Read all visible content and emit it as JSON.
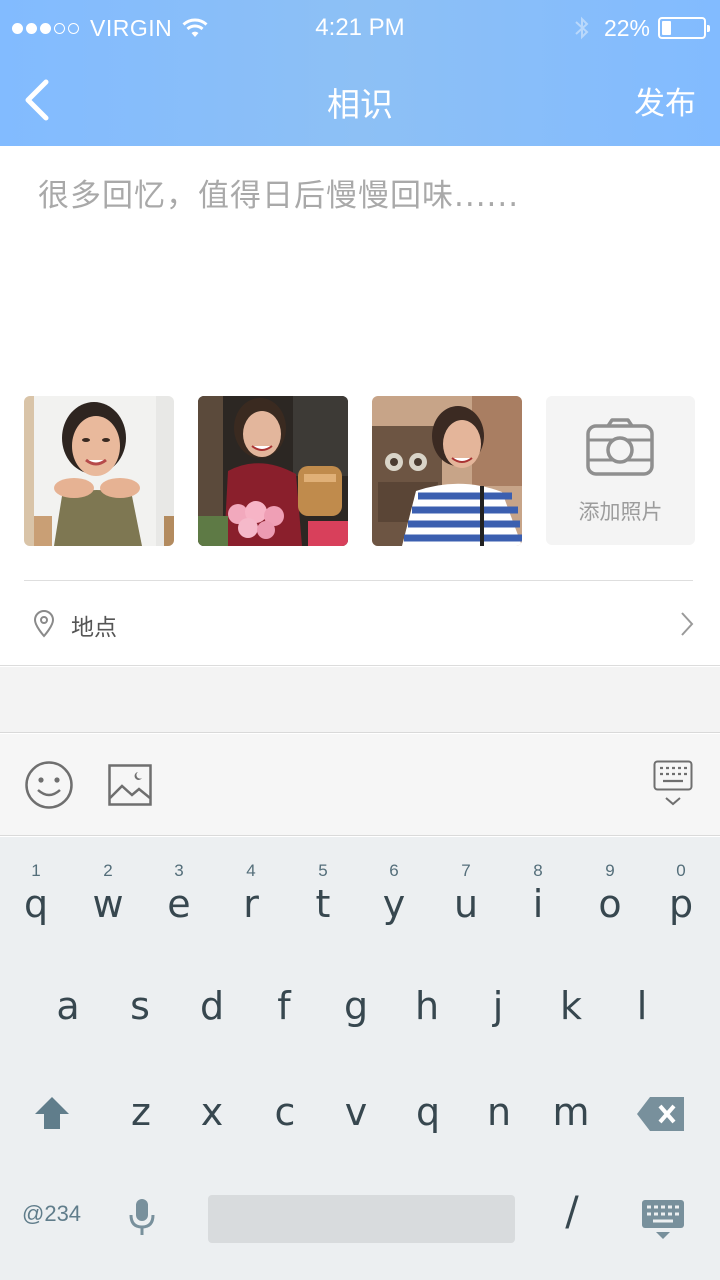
{
  "status_bar": {
    "carrier": "VIRGIN",
    "time": "4:21 PM",
    "battery_percent": "22%",
    "battery_level": 0.22,
    "signal_dots_filled": 3,
    "signal_dots_total": 5
  },
  "nav": {
    "back_icon": "chevron-left-icon",
    "title": "相识",
    "publish_label": "发布"
  },
  "composer": {
    "placeholder": "很多回忆，值得日后慢慢回味......"
  },
  "photos": {
    "items": [
      {
        "name": "photo-1",
        "description_icon": "photo-thumbnail"
      },
      {
        "name": "photo-2",
        "description_icon": "photo-thumbnail"
      },
      {
        "name": "photo-3",
        "description_icon": "photo-thumbnail"
      }
    ],
    "add_label": "添加照片",
    "add_icon": "camera-icon"
  },
  "location": {
    "label": "地点",
    "icon": "location-pin-icon",
    "chevron": "chevron-right-icon"
  },
  "toolbar": {
    "emoji_icon": "smiley-icon",
    "image_icon": "image-icon",
    "keyboard_icon": "keyboard-toggle-icon"
  },
  "keyboard": {
    "row1": [
      {
        "hint": "1",
        "ch": "q"
      },
      {
        "hint": "2",
        "ch": "w"
      },
      {
        "hint": "3",
        "ch": "e"
      },
      {
        "hint": "4",
        "ch": "r"
      },
      {
        "hint": "5",
        "ch": "t"
      },
      {
        "hint": "6",
        "ch": "y"
      },
      {
        "hint": "7",
        "ch": "u"
      },
      {
        "hint": "8",
        "ch": "i"
      },
      {
        "hint": "9",
        "ch": "o"
      },
      {
        "hint": "0",
        "ch": "p"
      }
    ],
    "row2": [
      "a",
      "s",
      "d",
      "f",
      "g",
      "h",
      "j",
      "k",
      "l"
    ],
    "row3": [
      "z",
      "x",
      "c",
      "v",
      "q",
      "n",
      "m"
    ],
    "sym_label": "@234",
    "slash_label": "/"
  },
  "colors": {
    "header": "#82bbff",
    "keyboard_bg": "#eceff1",
    "key_text": "#37474f"
  }
}
